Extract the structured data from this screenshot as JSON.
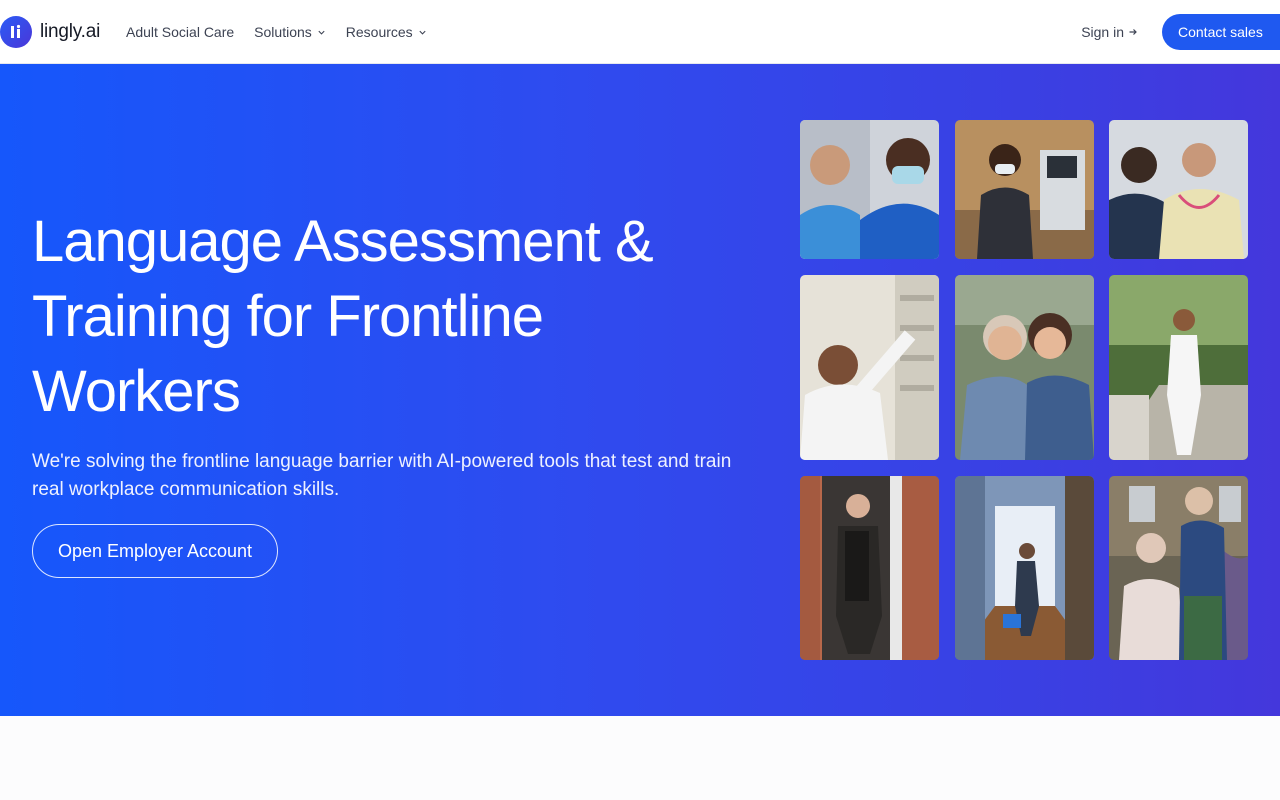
{
  "brand": {
    "name": "lingly.ai"
  },
  "nav": {
    "links": [
      {
        "label": "Adult Social Care"
      },
      {
        "label": "Solutions"
      },
      {
        "label": "Resources"
      }
    ],
    "sign_in": "Sign in",
    "contact": "Contact sales"
  },
  "hero": {
    "title": "Language Assessment & Training for Frontline Workers",
    "subtitle": "We're solving the frontline language barrier with AI-powered tools that test and train real workplace communication skills.",
    "cta": "Open Employer Account"
  },
  "colors": {
    "accent": "#1f59f0",
    "hero_start": "#1657fb",
    "hero_end": "#4437dc"
  },
  "photos": [
    {
      "name": "photo-caregiver-masked"
    },
    {
      "name": "photo-clinician-equipment"
    },
    {
      "name": "photo-nurse-patient"
    },
    {
      "name": "photo-pharmacy-worker"
    },
    {
      "name": "photo-elderly-woman-hug"
    },
    {
      "name": "photo-doctor-steps"
    },
    {
      "name": "photo-elderly-man-doorway"
    },
    {
      "name": "photo-cleaner-hallway"
    },
    {
      "name": "photo-elderly-couple-garden"
    }
  ]
}
